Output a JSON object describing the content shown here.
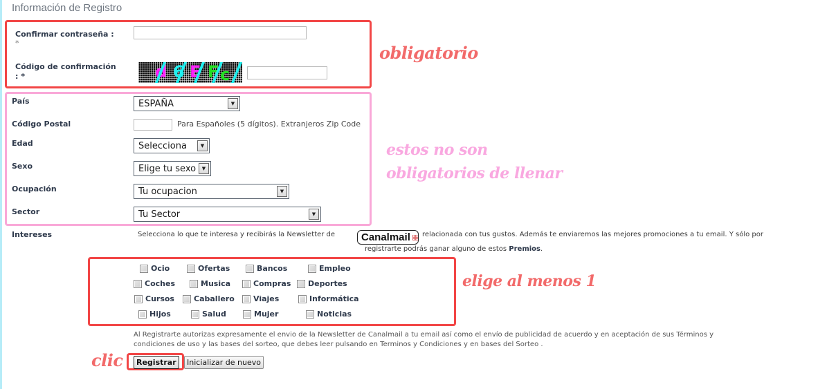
{
  "section_title": "Información de Registro",
  "required_group": {
    "confirm_password": {
      "label": "Confirmar contraseña :",
      "required_mark": "*",
      "value": ""
    },
    "confirmation_code": {
      "label": "Código de confirmación",
      "label_line2": ": *",
      "captcha_chars": [
        "d",
        "6",
        "E",
        "F",
        "c"
      ],
      "value": ""
    }
  },
  "optional_group": {
    "country": {
      "label": "País",
      "selected": "ESPAÑA"
    },
    "postal_code": {
      "label": "Código Postal",
      "value": "",
      "hint": "Para Españoles (5 dígitos). Extranjeros Zip Code"
    },
    "age": {
      "label": "Edad",
      "selected": "Selecciona"
    },
    "sex": {
      "label": "Sexo",
      "selected": "Elige tu sexo"
    },
    "occupation": {
      "label": "Ocupación",
      "selected": "Tu ocupacion"
    },
    "sector": {
      "label": "Sector",
      "selected": "Tu Sector"
    }
  },
  "interests": {
    "label": "Intereses",
    "intro_before_logo": "Selecciona lo que te interesa y recibirás la Newsletter de",
    "logo_text": "Canalmail",
    "intro_after_logo": "relacionada con tus gustos. Además te enviaremos las mejores promociones a tu email. Y sólo por",
    "intro_line2": "registrarte podrás ganar alguno de estos",
    "intro_prizes": "Premios",
    "intro_end": ".",
    "options": [
      [
        "Ocio",
        "Ofertas",
        "Bancos",
        "Empleo"
      ],
      [
        "Coches",
        "Musica",
        "Compras",
        "Deportes"
      ],
      [
        "Cursos",
        "Caballero",
        "Viajes",
        "Informática"
      ],
      [
        "Hijos",
        "Salud",
        "Mujer",
        "Noticias"
      ]
    ]
  },
  "legal": {
    "line1": "Al Registrarte autorizas expresamente el envio de la Newsletter de Canalmail a tu email así como el envío de publicidad de acuerdo y en aceptación de sus Términos y",
    "line2": "condiciones de uso y las bases del sorteo, que debes leer pulsando en Terminos y Condiciones y en bases del Sorteo ."
  },
  "buttons": {
    "register": "Registrar",
    "reset": "Inicializar de nuevo"
  },
  "annotations": {
    "required": "obligatorio",
    "optional_line1": "estos no son",
    "optional_line2": "obligatorios de llenar",
    "choose": "elige al menos 1",
    "click": "clic"
  },
  "colors": {
    "annotation_red": "#f24646",
    "annotation_pink": "#f9a8d8",
    "script_red": "#f26a6a",
    "script_pink": "#f9a8e0"
  }
}
